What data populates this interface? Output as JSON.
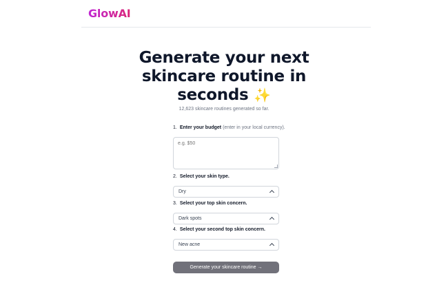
{
  "header": {
    "logo": "GlowAI"
  },
  "hero": {
    "title_line1": "Generate your next",
    "title_line2": "skincare routine in",
    "title_line3": "seconds",
    "sparkle": "✨",
    "count_text": "12,623 skincare routines generated so far."
  },
  "form": {
    "step1": {
      "num": "1.",
      "label": "Enter your budget",
      "hint": "(enter in your local currency).",
      "placeholder": "e.g. $50"
    },
    "step2": {
      "num": "2.",
      "label": "Select your skin type.",
      "value": "Dry"
    },
    "step3": {
      "num": "3.",
      "label": "Select your top skin concern.",
      "value": "Dark spots"
    },
    "step4": {
      "num": "4.",
      "label": "Select your second top skin concern.",
      "value": "New acne"
    },
    "submit_label": "Generate your skincare routine →"
  },
  "colors": {
    "brand_start": "#c026d3",
    "brand_end": "#db2777",
    "button": "#71717a"
  }
}
